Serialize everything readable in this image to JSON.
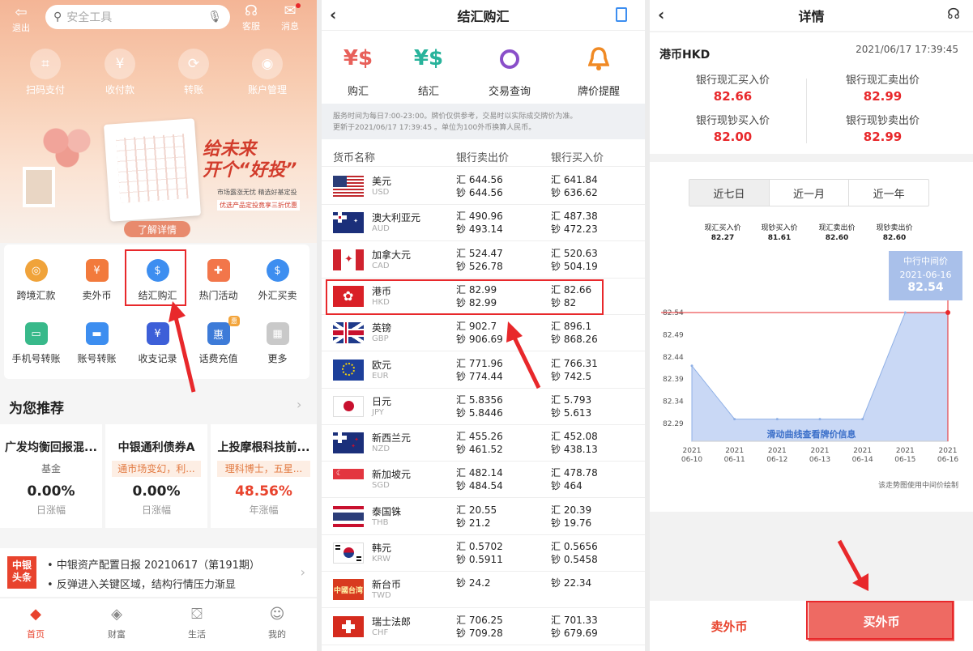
{
  "p1": {
    "top": {
      "exit": "退出",
      "search_placeholder": "安全工具",
      "service": "客服",
      "message": "消息"
    },
    "quick": [
      "扫码支付",
      "收付款",
      "转账",
      "账户管理"
    ],
    "banner": {
      "line1": "给未来",
      "line2": "开个“好投”",
      "slogan1": "市场露涨无忧 精选好基定投",
      "slogan2": "优选产品定投竟享三折优惠",
      "cta": "了解详情"
    },
    "grid": [
      "跨境汇款",
      "卖外币",
      "结汇购汇",
      "热门活动",
      "外汇买卖",
      "手机号转账",
      "账号转账",
      "收支记录",
      "话费充值",
      "更多"
    ],
    "grid_badge": "惠",
    "rec_title": "为您推荐",
    "rec": [
      {
        "title": "广发均衡回报混...",
        "sub": "基金",
        "value": "0.00%",
        "unit": "日涨幅"
      },
      {
        "title": "中银通利债券A",
        "sub": "通市场变幻，利...",
        "value": "0.00%",
        "unit": "日涨幅"
      },
      {
        "title": "上投摩根科技前...",
        "sub": "理科博士，五星...",
        "value": "48.56%",
        "unit": "年涨幅"
      }
    ],
    "news": {
      "logo": "中银头条",
      "l1": "中银资产配置日报 20210617（第191期）",
      "l2": "反弹进入关键区域，结构行情压力渐显"
    },
    "tabs": [
      "首页",
      "财富",
      "生活",
      "我的"
    ]
  },
  "p2": {
    "title": "结汇购汇",
    "menu": [
      {
        "icon": "¥$",
        "label": "购汇"
      },
      {
        "icon": "¥$",
        "label": "结汇"
      },
      {
        "icon": "Q",
        "label": "交易查询"
      },
      {
        "icon": "bell",
        "label": "牌价提醒"
      }
    ],
    "notice1": "服务时间为每日7:00-23:00。牌价仅供参考，交易时以实际成交牌价为准。",
    "notice2": "更新于2021/06/17 17:39:45 。单位为100外币换算人民币。",
    "head": [
      "货币名称",
      "银行卖出价",
      "银行买入价"
    ],
    "rows": [
      {
        "name": "美元",
        "code": "USD",
        "s1": "汇 644.56",
        "s2": "钞 644.56",
        "b1": "汇 641.84",
        "b2": "钞 636.62"
      },
      {
        "name": "澳大利亚元",
        "code": "AUD",
        "s1": "汇 490.96",
        "s2": "钞 493.14",
        "b1": "汇 487.38",
        "b2": "钞 472.23"
      },
      {
        "name": "加拿大元",
        "code": "CAD",
        "s1": "汇 524.47",
        "s2": "钞 526.78",
        "b1": "汇 520.63",
        "b2": "钞 504.19"
      },
      {
        "name": "港币",
        "code": "HKD",
        "s1": "汇 82.99",
        "s2": "钞 82.99",
        "b1": "汇 82.66",
        "b2": "钞 82"
      },
      {
        "name": "英镑",
        "code": "GBP",
        "s1": "汇 902.7",
        "s2": "钞 906.69",
        "b1": "汇 896.1",
        "b2": "钞 868.26"
      },
      {
        "name": "欧元",
        "code": "EUR",
        "s1": "汇 771.96",
        "s2": "钞 774.44",
        "b1": "汇 766.31",
        "b2": "钞 742.5"
      },
      {
        "name": "日元",
        "code": "JPY",
        "s1": "汇 5.8356",
        "s2": "钞 5.8446",
        "b1": "汇 5.793",
        "b2": "钞 5.613"
      },
      {
        "name": "新西兰元",
        "code": "NZD",
        "s1": "汇 455.26",
        "s2": "钞 461.52",
        "b1": "汇 452.08",
        "b2": "钞 438.13"
      },
      {
        "name": "新加坡元",
        "code": "SGD",
        "s1": "汇 482.14",
        "s2": "钞 484.54",
        "b1": "汇 478.78",
        "b2": "钞 464"
      },
      {
        "name": "泰国铢",
        "code": "THB",
        "s1": "汇 20.55",
        "s2": "钞 21.2",
        "b1": "汇 20.39",
        "b2": "钞 19.76"
      },
      {
        "name": "韩元",
        "code": "KRW",
        "s1": "汇 0.5702",
        "s2": "钞 0.5911",
        "b1": "汇 0.5656",
        "b2": "钞 0.5458"
      },
      {
        "name": "新台币",
        "code": "TWD",
        "s1": "",
        "s2": "钞 24.2",
        "b1": "",
        "b2": "钞 22.34"
      },
      {
        "name": "瑞士法郎",
        "code": "CHF",
        "s1": "汇 706.25",
        "s2": "钞 709.28",
        "b1": "汇 701.33",
        "b2": "钞 679.69"
      }
    ],
    "taiwan_flag_text": "中國台湾"
  },
  "p3": {
    "title": "详情",
    "currency": "港币HKD",
    "time": "2021/06/17 17:39:45",
    "prices": [
      {
        "label": "银行现汇买入价",
        "value": "82.66"
      },
      {
        "label": "银行现汇卖出价",
        "value": "82.99"
      },
      {
        "label": "银行现钞买入价",
        "value": "82.00"
      },
      {
        "label": "银行现钞卖出价",
        "value": "82.99"
      }
    ],
    "periods": [
      "近七日",
      "近一月",
      "近一年"
    ],
    "legend": [
      {
        "label": "现汇买入价",
        "value": "82.27"
      },
      {
        "label": "现钞买入价",
        "value": "81.61"
      },
      {
        "label": "现汇卖出价",
        "value": "82.60"
      },
      {
        "label": "现钞卖出价",
        "value": "82.60"
      }
    ],
    "tooltip": {
      "title": "中行中间价",
      "date": "2021-06-16",
      "value": "82.54"
    },
    "hint": "滑动曲线查看牌价信息",
    "footnote": "该走势图使用中间价绘制",
    "sell_btn": "卖外币",
    "buy_btn": "买外币",
    "colors": {
      "accent": "#e8282b",
      "price_red": "#e8282b",
      "chart_fill": "#c9d8f5",
      "buy_btn": "#ee6a63"
    }
  },
  "chart_data": {
    "type": "area",
    "x": [
      "2021 06-10",
      "2021 06-11",
      "2021 06-12",
      "2021 06-13",
      "2021 06-14",
      "2021 06-15",
      "2021 06-16"
    ],
    "values": [
      82.42,
      82.3,
      82.3,
      82.3,
      82.3,
      82.54,
      82.54
    ],
    "yticks": [
      "82.54",
      "82.49",
      "82.44",
      "82.39",
      "82.34",
      "82.29"
    ],
    "ylim": [
      82.25,
      82.56
    ],
    "grid": false
  }
}
